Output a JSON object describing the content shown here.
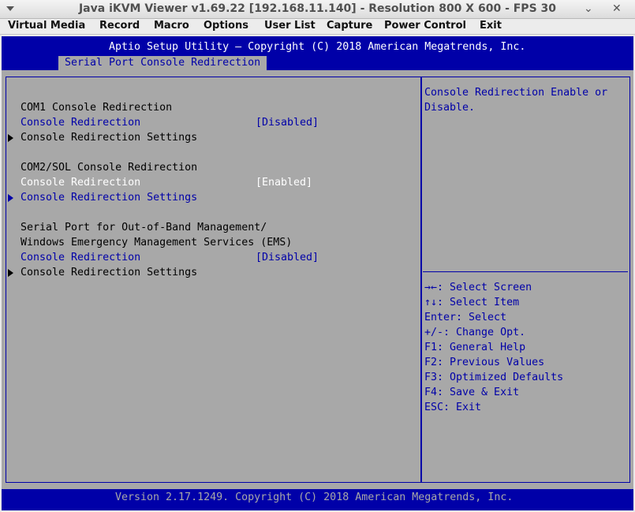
{
  "window": {
    "title": "Java iKVM Viewer v1.69.22 [192.168.11.140]  - Resolution 800 X 600 - FPS 30",
    "minimize_glyph": "⌄",
    "close_glyph": "✕"
  },
  "menubar": {
    "items": [
      "Virtual Media",
      "Record",
      "Macro",
      "Options",
      "User List",
      "Capture",
      "Power Control",
      "Exit"
    ]
  },
  "bios": {
    "header": "Aptio Setup Utility – Copyright (C) 2018 American Megatrends, Inc.",
    "tab": "Serial Port Console Redirection",
    "sections": [
      {
        "heading": "COM1 Console Redirection",
        "item_label": "Console Redirection",
        "item_value": "[Disabled]",
        "submenu": "Console Redirection Settings"
      },
      {
        "heading": "COM2/SOL Console Redirection",
        "item_label": "Console Redirection",
        "item_value": "[Enabled]",
        "submenu": "Console Redirection Settings"
      },
      {
        "heading_line1": "Serial Port for Out-of-Band Management/",
        "heading_line2": "Windows Emergency Management Services (EMS)",
        "item_label": "Console Redirection",
        "item_value": "[Disabled]",
        "submenu": "Console Redirection Settings"
      }
    ],
    "help": {
      "line1": "Console Redirection Enable or",
      "line2": "Disable."
    },
    "keys": [
      "→←: Select Screen",
      "↑↓: Select Item",
      "Enter: Select",
      "+/-: Change Opt.",
      "F1: General Help",
      "F2: Previous Values",
      "F3: Optimized Defaults",
      "F4: Save & Exit",
      "ESC: Exit"
    ],
    "footer": "Version 2.17.1249. Copyright (C) 2018 American Megatrends, Inc.",
    "colors": {
      "background": "#a8a8a8",
      "blue": "#0000a8",
      "white": "#ffffff",
      "black": "#000000"
    }
  }
}
